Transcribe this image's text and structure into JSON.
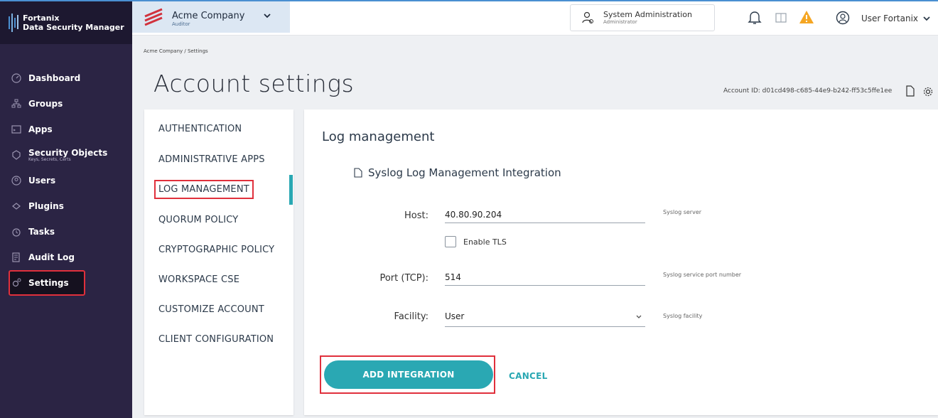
{
  "brand": {
    "line1": "Fortanix",
    "line2": "Data Security Manager"
  },
  "sidebar": {
    "items": [
      {
        "label": "Dashboard",
        "icon": "dashboard-icon"
      },
      {
        "label": "Groups",
        "icon": "groups-icon"
      },
      {
        "label": "Apps",
        "icon": "apps-icon"
      },
      {
        "label": "Security Objects",
        "sub": "Keys, Secrets, Certs",
        "icon": "security-objects-icon"
      },
      {
        "label": "Users",
        "icon": "users-icon"
      },
      {
        "label": "Plugins",
        "icon": "plugins-icon"
      },
      {
        "label": "Tasks",
        "icon": "tasks-icon"
      },
      {
        "label": "Audit Log",
        "icon": "audit-log-icon"
      },
      {
        "label": "Settings",
        "icon": "settings-icon",
        "active": true
      }
    ]
  },
  "header": {
    "company_name": "Acme Company",
    "company_role": "Auditor",
    "sysadmin_title": "System Administration",
    "sysadmin_role": "Administrator",
    "user_name": "User Fortanix"
  },
  "breadcrumb": "Acme Company / Settings",
  "page": {
    "title": "Account settings",
    "account_id": "Account ID: d01cd498-c685-44e9-b242-ff53c5ffe1ee"
  },
  "settings_menu": {
    "items": [
      "AUTHENTICATION",
      "ADMINISTRATIVE APPS",
      "LOG MANAGEMENT",
      "QUORUM POLICY",
      "CRYPTOGRAPHIC POLICY",
      "WORKSPACE CSE",
      "CUSTOMIZE ACCOUNT",
      "CLIENT CONFIGURATION"
    ],
    "active_index": 2
  },
  "content": {
    "section_title": "Log management",
    "sub_title": "Syslog Log Management Integration",
    "host": {
      "label": "Host:",
      "value": "40.80.90.204",
      "hint": "Syslog server"
    },
    "tls": {
      "label": "Enable TLS",
      "checked": false
    },
    "port": {
      "label": "Port (TCP):",
      "value": "514",
      "hint": "Syslog service port number"
    },
    "facility": {
      "label": "Facility:",
      "value": "User",
      "hint": "Syslog facility"
    },
    "add_button": "ADD INTEGRATION",
    "cancel_button": "CANCEL"
  },
  "colors": {
    "sidebar": "#2b2444",
    "accent": "#2aa8b3",
    "highlight": "#e0303c"
  }
}
